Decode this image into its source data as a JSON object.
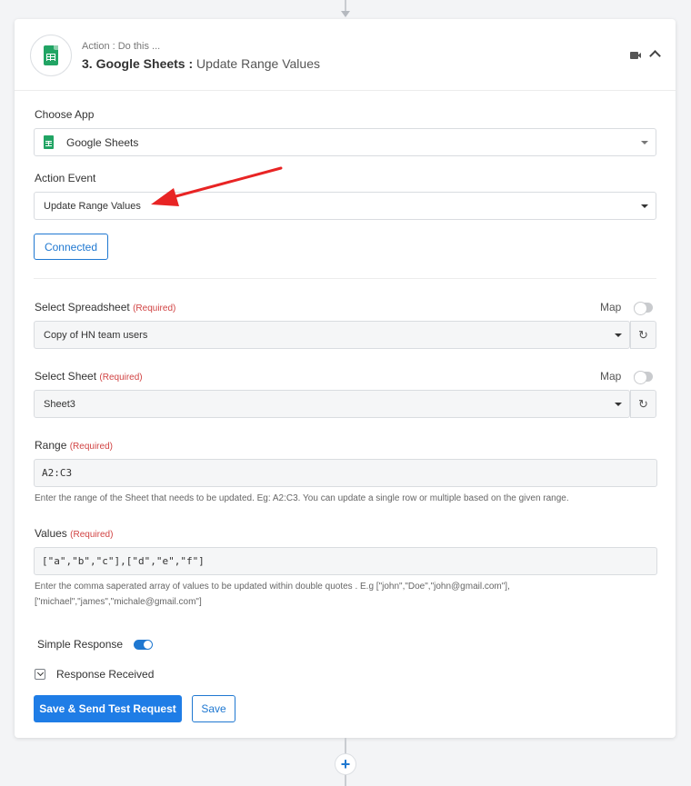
{
  "header": {
    "subtitle": "Action : Do this ...",
    "step_title": "3. Google Sheets",
    "separator": " : ",
    "event_name": "Update Range Values"
  },
  "choose_app": {
    "label": "Choose App",
    "value": "Google Sheets"
  },
  "action_event": {
    "label": "Action Event",
    "value": "Update Range Values"
  },
  "connection": {
    "button_label": "Connected"
  },
  "spreadsheet": {
    "label": "Select Spreadsheet",
    "required": "(Required)",
    "map_label": "Map",
    "value": "Copy of HN team users",
    "refresh_icon": "↻"
  },
  "sheet": {
    "label": "Select Sheet",
    "required": "(Required)",
    "map_label": "Map",
    "value": "Sheet3",
    "refresh_icon": "↻"
  },
  "range": {
    "label": "Range",
    "required": "(Required)",
    "value": "A2:C3",
    "help": "Enter the range of the Sheet that needs to be updated. Eg: A2:C3. You can update a single row or multiple based on the given range."
  },
  "values": {
    "label": "Values",
    "required": "(Required)",
    "value": "[\"a\",\"b\",\"c\"],[\"d\",\"e\",\"f\"]",
    "help": "Enter the comma saperated array of values to be updated within double quotes . E.g [\"john\",\"Doe\",\"john@gmail.com\"], [\"michael\",\"james\",\"michale@gmail.com\"]"
  },
  "simple_response": {
    "label": "Simple Response",
    "enabled": true
  },
  "response_received": {
    "label": "Response Received"
  },
  "buttons": {
    "save_send": "Save & Send Test Request",
    "save": "Save"
  },
  "add_step_icon": "+",
  "colors": {
    "accent": "#1f78d1",
    "sheets_green": "#21a464",
    "required_red": "#d14343",
    "annotation_arrow": "#e82424"
  }
}
